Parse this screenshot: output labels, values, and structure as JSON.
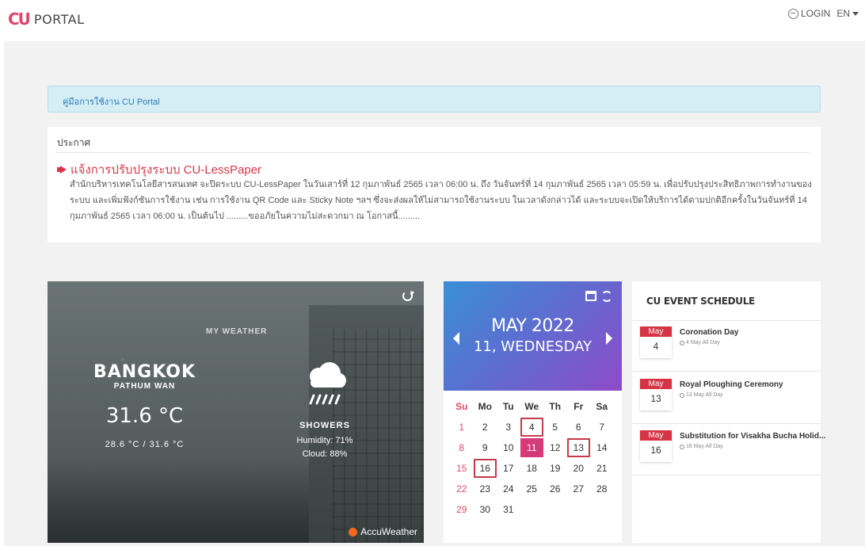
{
  "header": {
    "logo_mark": "CU",
    "logo_text": "PORTAL",
    "login_label": "LOGIN",
    "lang_label": "EN"
  },
  "guide": {
    "link_text": "คู่มือการใช้งาน CU Portal"
  },
  "announcement": {
    "heading": "ประกาศ",
    "title": "แจ้งการปรับปรุงระบบ CU-LessPaper",
    "body": "สำนักบริหารเทคโนโลยีสารสนเทศ จะปิดระบบ CU-LessPaper ในวันเสาร์ที่ 12 กุมภาพันธ์ 2565 เวลา 06:00 น. ถึง วันจันทร์ที่ 14 กุมภาพันธ์ 2565 เวลา 05:59 น. เพื่อปรับปรุงประสิทธิภาพการทำงานของระบบ และเพิ่มฟังก์ชันการใช้งาน เช่น การใช้งาน QR Code และ Sticky Note ฯลฯ ซึ่งจะส่งผลให้ไม่สามารถใช้งานระบบ ในเวลาดังกล่าวได้ และระบบจะเปิดให้บริการได้ตามปกติอีกครั้งในวันจันทร์ที่ 14 กุมภาพันธ์ 2565 เวลา 06:00 น. เป็นต้นไป .........ขออภัยในความไม่สะดวกมา ณ โอกาสนี้.........",
    "accent_color": "#d9364a"
  },
  "weather": {
    "section_label": "MY WEATHER",
    "city": "BANGKOK",
    "district": "PATHUM WAN",
    "temperature": "31.6 °C",
    "range": "28.6 °C / 31.6 °C",
    "condition": "SHOWERS",
    "humidity": "Humidity: 71%",
    "cloud": "Cloud: 88%",
    "provider": "AccuWeather",
    "icon": "rain-cloud-icon"
  },
  "calendar": {
    "month_year": "MAY 2022",
    "day_line": "11, WEDNESDAY",
    "weekdays": [
      "Su",
      "Mo",
      "Tu",
      "We",
      "Th",
      "Fr",
      "Sa"
    ],
    "weeks": [
      [
        "1",
        "2",
        "3",
        "4",
        "5",
        "6",
        "7"
      ],
      [
        "8",
        "9",
        "10",
        "11",
        "12",
        "13",
        "14"
      ],
      [
        "15",
        "16",
        "17",
        "18",
        "19",
        "20",
        "21"
      ],
      [
        "22",
        "23",
        "24",
        "25",
        "26",
        "27",
        "28"
      ],
      [
        "29",
        "30",
        "31",
        "",
        "",
        "",
        ""
      ]
    ],
    "today": "11",
    "event_days": [
      "4",
      "13",
      "16"
    ],
    "today_color": "#d63a7a",
    "event_color": "#c43b4b"
  },
  "events": {
    "title": "CU EVENT SCHEDULE",
    "items": [
      {
        "month": "May",
        "day": "4",
        "name": "Coronation Day",
        "when": "4 May All Day"
      },
      {
        "month": "May",
        "day": "13",
        "name": "Royal Ploughing Ceremony",
        "when": "13 May All Day"
      },
      {
        "month": "May",
        "day": "16",
        "name": "Substitution for Visakha Bucha Holid...",
        "when": "16 May All Day"
      }
    ]
  }
}
